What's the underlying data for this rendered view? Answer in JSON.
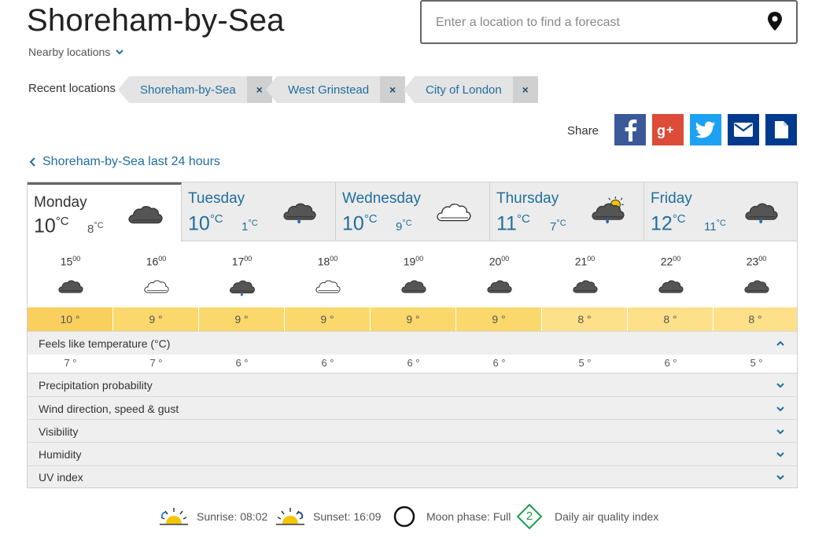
{
  "location": {
    "title": "Shoreham-by-Sea",
    "nearby_label": "Nearby locations"
  },
  "search": {
    "placeholder": "Enter a location to find a forecast",
    "icon": "map-pin-icon"
  },
  "recent": {
    "label": "Recent locations",
    "items": [
      {
        "name": "Shoreham-by-Sea",
        "remove": "×"
      },
      {
        "name": "West Grinstead",
        "remove": "×"
      },
      {
        "name": "City of London",
        "remove": "×"
      }
    ]
  },
  "share": {
    "label": "Share",
    "buttons": [
      {
        "icon": "facebook-icon",
        "color": "#3b5998"
      },
      {
        "icon": "google-plus-icon",
        "color": "#dd4b39"
      },
      {
        "icon": "twitter-icon",
        "color": "#1da1f2"
      },
      {
        "icon": "email-icon",
        "color": "#003a8f"
      },
      {
        "icon": "document-icon",
        "color": "#003a8f"
      }
    ]
  },
  "back_link": "Shoreham-by-Sea last 24 hours",
  "days": [
    {
      "name": "Monday",
      "high": "10",
      "low": "8",
      "unit": "°C",
      "icon": "cloudy-icon",
      "active": true
    },
    {
      "name": "Tuesday",
      "high": "10",
      "low": "1",
      "unit": "°C",
      "icon": "light-rain-icon",
      "active": false
    },
    {
      "name": "Wednesday",
      "high": "10",
      "low": "9",
      "unit": "°C",
      "icon": "white-cloud-icon",
      "active": false
    },
    {
      "name": "Thursday",
      "high": "11",
      "low": "7",
      "unit": "°C",
      "icon": "sunny-shower-icon",
      "active": false
    },
    {
      "name": "Friday",
      "high": "12",
      "low": "11",
      "unit": "°C",
      "icon": "light-rain-icon",
      "active": false
    }
  ],
  "hours": [
    {
      "h": "15",
      "m": "00",
      "icon": "cloudy-icon",
      "temp": "10 °",
      "feels": "7 °"
    },
    {
      "h": "16",
      "m": "00",
      "icon": "white-cloud-icon",
      "temp": "9 °",
      "feels": "7 °"
    },
    {
      "h": "17",
      "m": "00",
      "icon": "light-rain-icon",
      "temp": "9 °",
      "feels": "6 °"
    },
    {
      "h": "18",
      "m": "00",
      "icon": "white-cloud-icon",
      "temp": "9 °",
      "feels": "6 °"
    },
    {
      "h": "19",
      "m": "00",
      "icon": "cloudy-icon",
      "temp": "9 °",
      "feels": "6 °"
    },
    {
      "h": "20",
      "m": "00",
      "icon": "cloudy-icon",
      "temp": "9 °",
      "feels": "6 °"
    },
    {
      "h": "21",
      "m": "00",
      "icon": "cloudy-icon",
      "temp": "8 °",
      "feels": "5 °"
    },
    {
      "h": "22",
      "m": "00",
      "icon": "cloudy-icon",
      "temp": "8 °",
      "feels": "6 °"
    },
    {
      "h": "23",
      "m": "00",
      "icon": "cloudy-icon",
      "temp": "8 °",
      "feels": "5 °"
    }
  ],
  "rows": {
    "feels_like": "Feels like temperature (°C)",
    "precipitation": "Precipitation probability",
    "wind": "Wind direction, speed & gust",
    "visibility": "Visibility",
    "humidity": "Humidity",
    "uv": "UV index"
  },
  "footer": {
    "sunrise": "Sunrise: 08:02",
    "sunset": "Sunset: 16:09",
    "moon": "Moon phase: Full",
    "aqi_value": "2",
    "aqi_label": "Daily air quality index"
  },
  "colors": {
    "link": "#1f6e9e",
    "temp_10": "#f9cf5d",
    "temp_9": "#fbd86b",
    "temp_8": "#fde089",
    "aqi": "#1a9e4a"
  }
}
